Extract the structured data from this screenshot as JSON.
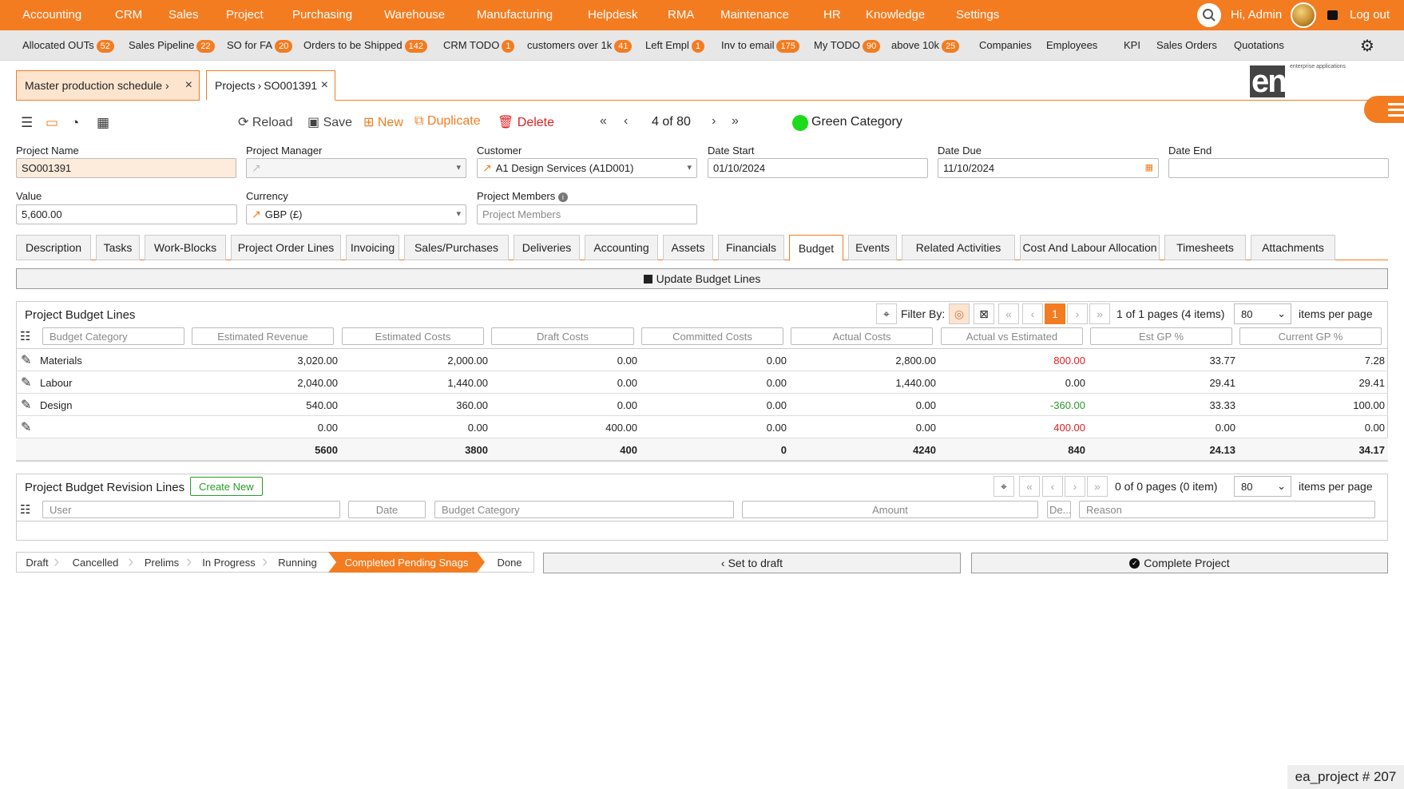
{
  "topnav": {
    "items": [
      "Accounting",
      "CRM",
      "Sales",
      "Project",
      "Purchasing",
      "Warehouse",
      "Manufacturing",
      "Helpdesk",
      "RMA",
      "Maintenance",
      "HR",
      "Knowledge",
      "Settings"
    ],
    "greeting": "Hi, Admin",
    "logout": "Log out"
  },
  "favorites": [
    {
      "label": "Allocated OUTs",
      "count": "52"
    },
    {
      "label": "Sales Pipeline",
      "count": "22"
    },
    {
      "label": "SO for FA",
      "count": "20"
    },
    {
      "label": "Orders to be Shipped",
      "count": "142"
    },
    {
      "label": "CRM TODO",
      "count": "1"
    },
    {
      "label": "customers over 1k",
      "count": "41"
    },
    {
      "label": "Left Empl",
      "count": "1"
    },
    {
      "label": "Inv to email",
      "count": "175"
    },
    {
      "label": "My TODO",
      "count": "90"
    },
    {
      "label": "above 10k",
      "count": "25"
    },
    {
      "label": "Companies",
      "count": ""
    },
    {
      "label": "Employees",
      "count": ""
    },
    {
      "label": "KPI",
      "count": ""
    },
    {
      "label": "Sales Orders",
      "count": ""
    },
    {
      "label": "Quotations",
      "count": ""
    }
  ],
  "window_tabs": [
    {
      "label": "Master production schedule"
    },
    {
      "label": "Projects",
      "record": "SO001391"
    }
  ],
  "logo": {
    "main": "enapps",
    "sub": "enterprise applications"
  },
  "toolbar": {
    "reload": "Reload",
    "save": "Save",
    "new": "New",
    "duplicate": "Duplicate",
    "delete": "Delete",
    "pager": "4 of 80",
    "category": "Green Category"
  },
  "form": {
    "project_name": {
      "label": "Project Name",
      "value": "SO001391"
    },
    "project_manager": {
      "label": "Project Manager",
      "value": ""
    },
    "customer": {
      "label": "Customer",
      "value": "A1 Design Services (A1D001)"
    },
    "date_start": {
      "label": "Date Start",
      "value": "01/10/2024"
    },
    "date_due": {
      "label": "Date Due",
      "value": "11/10/2024"
    },
    "date_end": {
      "label": "Date End",
      "value": ""
    },
    "value": {
      "label": "Value",
      "value": "5,600.00"
    },
    "currency": {
      "label": "Currency",
      "value": "GBP (£)"
    },
    "members": {
      "label": "Project Members",
      "placeholder": "Project Members"
    }
  },
  "section_tabs": [
    "Description",
    "Tasks",
    "Work-Blocks",
    "Project Order Lines",
    "Invoicing",
    "Sales/Purchases",
    "Deliveries",
    "Accounting",
    "Assets",
    "Financials",
    "Budget",
    "Events",
    "Related Activities",
    "Cost And Labour Allocation",
    "Timesheets",
    "Attachments"
  ],
  "update_budget": "Update Budget Lines",
  "budget": {
    "title": "Project Budget Lines",
    "filter_by": "Filter By:",
    "page": "1",
    "page_info": "1 of 1 pages (4 items)",
    "per_page": "80",
    "per_page_label": "items per page",
    "columns": [
      "Budget Category",
      "Estimated Revenue",
      "Estimated Costs",
      "Draft Costs",
      "Committed Costs",
      "Actual Costs",
      "Actual vs Estimated",
      "Est GP %",
      "Current GP %"
    ],
    "rows": [
      [
        "Materials",
        "3,020.00",
        "2,000.00",
        "0.00",
        "0.00",
        "2,800.00",
        "800.00",
        "33.77",
        "7.28"
      ],
      [
        "Labour",
        "2,040.00",
        "1,440.00",
        "0.00",
        "0.00",
        "1,440.00",
        "0.00",
        "29.41",
        "29.41"
      ],
      [
        "Design",
        "540.00",
        "360.00",
        "0.00",
        "0.00",
        "0.00",
        "-360.00",
        "33.33",
        "100.00"
      ],
      [
        "",
        "0.00",
        "0.00",
        "400.00",
        "0.00",
        "0.00",
        "400.00",
        "0.00",
        "0.00"
      ]
    ],
    "totals": [
      "5600",
      "3800",
      "400",
      "0",
      "4240",
      "840",
      "24.13",
      "34.17"
    ]
  },
  "revisions": {
    "title": "Project Budget Revision Lines",
    "create_new": "Create New",
    "page_info": "0 of 0 pages (0 item)",
    "per_page": "80",
    "per_page_label": "items per page",
    "columns": [
      "User",
      "Date",
      "Budget Category",
      "Amount",
      "De...",
      "Reason"
    ]
  },
  "stages": [
    "Draft",
    "Cancelled",
    "Prelims",
    "In Progress",
    "Running",
    "Completed Pending Snags",
    "Done"
  ],
  "active_stage": "Completed Pending Snags",
  "actions": {
    "set_draft": "Set to draft",
    "complete": "Complete Project"
  },
  "footer_tag": "ea_project # 207",
  "colors": {
    "accent": "#f47c20",
    "negative": "#e02020",
    "positive": "#2a9a2a",
    "category": "#1bdb1b"
  }
}
